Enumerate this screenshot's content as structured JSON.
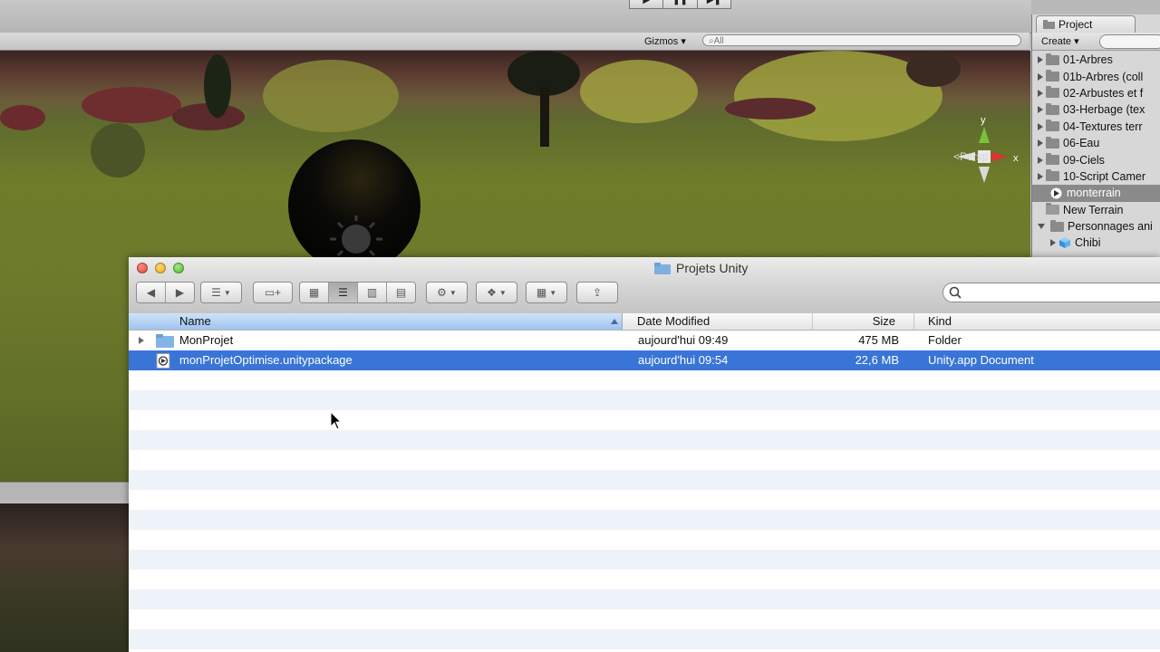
{
  "unity": {
    "scene_toolbar": {
      "gizmos_label": "Gizmos",
      "search_placeholder": "All"
    },
    "scene_view": {
      "camera_mode": "Persp",
      "axis_y": "y",
      "axis_x": "x"
    },
    "project_panel": {
      "tab_label": "Project",
      "create_label": "Create",
      "items": [
        {
          "label": "01-Arbres",
          "type": "folder",
          "expanded": false
        },
        {
          "label": "01b-Arbres (coll",
          "type": "folder",
          "expanded": false
        },
        {
          "label": "02-Arbustes et f",
          "type": "folder",
          "expanded": false
        },
        {
          "label": "03-Herbage (tex",
          "type": "folder",
          "expanded": false
        },
        {
          "label": "04-Textures terr",
          "type": "folder",
          "expanded": false
        },
        {
          "label": "06-Eau",
          "type": "folder",
          "expanded": false
        },
        {
          "label": "09-Ciels",
          "type": "folder",
          "expanded": false
        },
        {
          "label": "10-Script Camer",
          "type": "folder",
          "expanded": false
        },
        {
          "label": "monterrain",
          "type": "unity-scene",
          "selected": true
        },
        {
          "label": "New Terrain",
          "type": "terrain"
        },
        {
          "label": "Personnages ani",
          "type": "folder",
          "expanded": true
        },
        {
          "label": "Chibi",
          "type": "prefab"
        }
      ]
    }
  },
  "finder": {
    "window_title": "Projets Unity",
    "columns": {
      "name": "Name",
      "date": "Date Modified",
      "size": "Size",
      "kind": "Kind"
    },
    "rows": [
      {
        "name": "MonProjet",
        "date": "aujourd'hui 09:49",
        "size": "475 MB",
        "kind": "Folder",
        "icon": "folder-icon"
      },
      {
        "name": "monProjetOptimise.unitypackage",
        "date": "aujourd'hui 09:54",
        "size": "22,6 MB",
        "kind": "Unity.app Document",
        "icon": "unity-package-icon"
      }
    ],
    "selected_view": "list",
    "colors": {
      "selection": "#3875d7",
      "header_sorted": "#9ec3ef",
      "stripe": "#eef3fa"
    }
  }
}
